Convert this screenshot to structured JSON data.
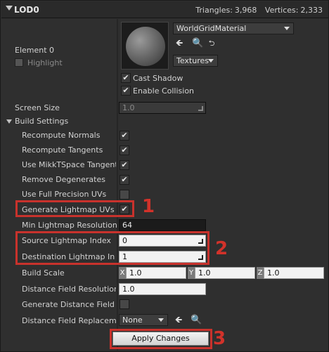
{
  "header": {
    "title": "LOD0",
    "triangles_label": "Triangles:",
    "triangles_value": "3,968",
    "vertices_label": "Vertices:",
    "vertices_value": "2,333"
  },
  "element": {
    "label": "Element 0",
    "highlight_label": "Highlight"
  },
  "material": {
    "name": "WorldGridMaterial",
    "textures_label": "Textures"
  },
  "options": {
    "cast_shadow": "Cast Shadow",
    "enable_collision": "Enable Collision"
  },
  "screen_size": {
    "label": "Screen Size",
    "value": "1.0"
  },
  "build_settings": {
    "label": "Build Settings",
    "rows": [
      {
        "label": "Recompute Normals",
        "checked": true
      },
      {
        "label": "Recompute Tangents",
        "checked": true
      },
      {
        "label": "Use MikkTSpace Tangent",
        "checked": true
      },
      {
        "label": "Remove Degenerates",
        "checked": true
      },
      {
        "label": "Use Full Precision UVs",
        "checked": false
      },
      {
        "label": "Generate Lightmap UVs",
        "checked": true
      }
    ],
    "min_lightmap_label": "Min Lightmap Resolution",
    "min_lightmap_value": "64",
    "source_lightmap_label": "Source Lightmap Index",
    "source_lightmap_value": "0",
    "dest_lightmap_label": "Destination Lightmap Inde",
    "dest_lightmap_value": "1",
    "build_scale_label": "Build Scale",
    "build_scale": {
      "x_label": "X",
      "x": "1.0",
      "y_label": "Y",
      "y": "1.0",
      "z_label": "Z",
      "z": "1.0"
    },
    "dist_field_res_label": "Distance Field Resolution S",
    "dist_field_res_value": "1.0",
    "gen_dist_field_label": "Generate Distance Field as",
    "dist_field_repl_label": "Distance Field Replacemen",
    "dist_field_repl_value": "None"
  },
  "apply_button": "Apply Changes",
  "annotations": {
    "n1": "1",
    "n2": "2",
    "n3": "3"
  },
  "colors": {
    "accent_red": "#c8322c"
  }
}
